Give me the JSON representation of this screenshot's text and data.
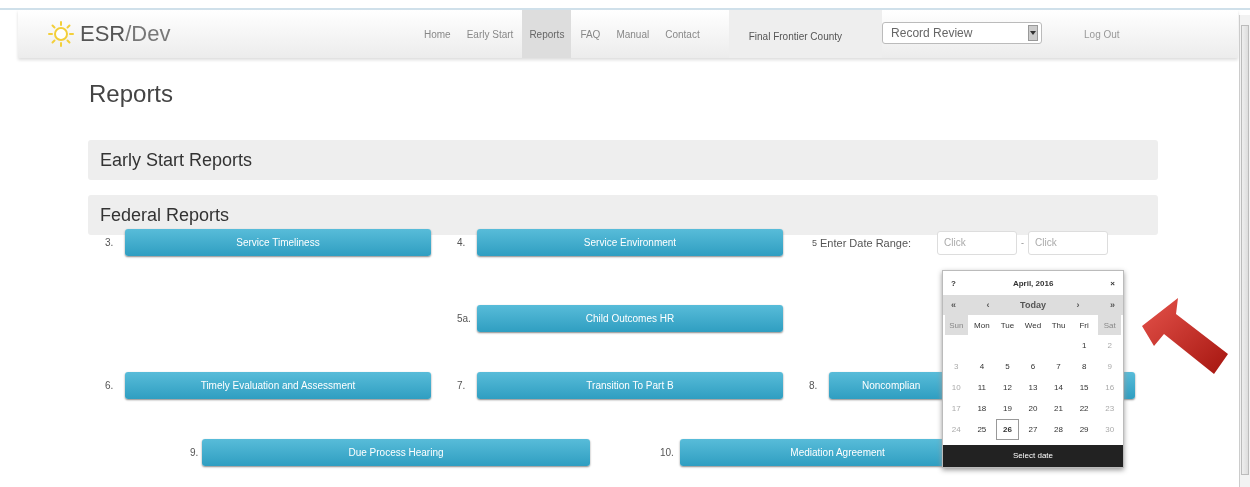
{
  "brand": {
    "name": "ESR",
    "suffix": "/Dev"
  },
  "nav": [
    {
      "label": "Home",
      "selected": false
    },
    {
      "label": "Early Start",
      "selected": false
    },
    {
      "label": "Reports",
      "selected": true
    },
    {
      "label": "FAQ",
      "selected": false
    },
    {
      "label": "Manual",
      "selected": false
    },
    {
      "label": "Contact",
      "selected": false
    }
  ],
  "county": "Final Frontier County",
  "role_select": {
    "value": "Record Review"
  },
  "logout": "Log Out",
  "page_title": "Reports",
  "sections": [
    {
      "title": "Early Start Reports"
    },
    {
      "title": "Federal Reports"
    }
  ],
  "federal_rows": [
    {
      "items": [
        {
          "kind": "button",
          "number": "3.",
          "label": "Service Timeliness"
        },
        {
          "kind": "button",
          "number": "4.",
          "label": "Service Environment"
        },
        {
          "kind": "date_range",
          "number": "5",
          "label": "Enter Date Range:",
          "from_placeholder": "Click",
          "separator": "-",
          "to_placeholder": "Click"
        }
      ]
    },
    {
      "items": [
        {
          "kind": "button",
          "number": "5a.",
          "label": "Child Outcomes HR"
        }
      ]
    },
    {
      "items": [
        {
          "kind": "button",
          "number": "6.",
          "label": "Timely Evaluation and Assessment"
        },
        {
          "kind": "button",
          "number": "7.",
          "label": "Transition To Part B"
        },
        {
          "kind": "button",
          "number": "8.",
          "label": "Noncomplian"
        }
      ]
    },
    {
      "items": [
        {
          "kind": "button",
          "number": "9.",
          "label": "Due Process Hearing"
        },
        {
          "kind": "button",
          "number": "10.",
          "label": "Mediation Agreement"
        }
      ]
    }
  ],
  "calendar": {
    "help": "?",
    "title": "April, 2016",
    "close": "×",
    "nav": [
      "«",
      "‹",
      "Today",
      "›",
      "»"
    ],
    "weekdays": [
      {
        "label": "Sun",
        "weekend": true
      },
      {
        "label": "Mon",
        "weekend": false
      },
      {
        "label": "Tue",
        "weekend": false
      },
      {
        "label": "Wed",
        "weekend": false
      },
      {
        "label": "Thu",
        "weekend": false
      },
      {
        "label": "Fri",
        "weekend": false
      },
      {
        "label": "Sat",
        "weekend": true
      }
    ],
    "weeks": [
      {
        "days": [
          {
            "label": "1",
            "selected": false
          },
          {
            "label": "2",
            "selected": false
          }
        ]
      },
      {
        "days": [
          {
            "label": "3",
            "selected": false
          },
          {
            "label": "4",
            "selected": false
          },
          {
            "label": "5",
            "selected": false
          },
          {
            "label": "6",
            "selected": false
          },
          {
            "label": "7",
            "selected": false
          },
          {
            "label": "8",
            "selected": false
          },
          {
            "label": "9",
            "selected": false
          }
        ]
      },
      {
        "days": [
          {
            "label": "10",
            "selected": false
          },
          {
            "label": "11",
            "selected": false
          },
          {
            "label": "12",
            "selected": false
          },
          {
            "label": "13",
            "selected": false
          },
          {
            "label": "14",
            "selected": false
          },
          {
            "label": "15",
            "selected": false
          },
          {
            "label": "16",
            "selected": false
          }
        ]
      },
      {
        "days": [
          {
            "label": "17",
            "selected": false
          },
          {
            "label": "18",
            "selected": false
          },
          {
            "label": "19",
            "selected": false
          },
          {
            "label": "20",
            "selected": false
          },
          {
            "label": "21",
            "selected": false
          },
          {
            "label": "22",
            "selected": false
          },
          {
            "label": "23",
            "selected": false
          }
        ]
      },
      {
        "days": [
          {
            "label": "24",
            "selected": false
          },
          {
            "label": "25",
            "selected": false
          },
          {
            "label": "26",
            "selected": true
          },
          {
            "label": "27",
            "selected": false
          },
          {
            "label": "28",
            "selected": false
          },
          {
            "label": "29",
            "selected": false
          },
          {
            "label": "30",
            "selected": false
          }
        ]
      }
    ],
    "footer": "Select date"
  }
}
